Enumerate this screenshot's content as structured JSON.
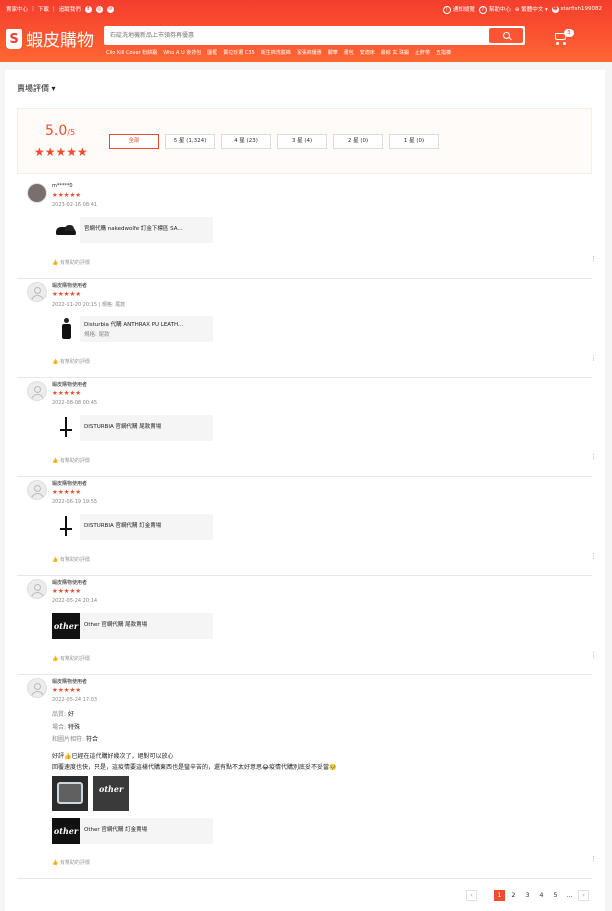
{
  "topbar": {
    "seller_center": "賣家中心",
    "download": "下載",
    "follow_us": "追蹤我們",
    "facebook_icon": "f",
    "instagram_icon": "◎",
    "line_icon": "✉",
    "notifications": "通知總覽",
    "notifications_badge": "!",
    "help": "幫助中心",
    "help_icon": "?",
    "language": "繁體中文",
    "language_icon": "⊕",
    "username": "starfish199082",
    "user_icon": "☻"
  },
  "header": {
    "logo_mark": "S",
    "logo_text": "蝦皮購物",
    "search_placeholder": "石碇洗地機新品上市領券再優惠",
    "cart_count": "3",
    "hints": [
      "Clio Kill Cover 粉餅霜",
      "Who A U 後背包",
      "圖框",
      "賣拉珍選 C35",
      "衛生棉洗臉棉",
      "潔張商優惠",
      "腳華",
      "書包",
      "安適床",
      "最綜 玄 珠鍛",
      "止鼾帶",
      "五指襪"
    ]
  },
  "ratings": {
    "title": "賣場評價",
    "score": "5.0",
    "score_suffix": "/5",
    "score_stars": "★★★★★",
    "filters": [
      {
        "label": "全部",
        "active": true
      },
      {
        "label": "5 星 (1,324)"
      },
      {
        "label": "4 星 (23)"
      },
      {
        "label": "3 星 (4)"
      },
      {
        "label": "2 星 (0)"
      },
      {
        "label": "1 星 (0)"
      }
    ]
  },
  "reviews": [
    {
      "user": "m*****0",
      "stars": "★★★★★",
      "date": "2023-02-16 08:41",
      "product": "官網代購 nakedwolfe 訂金下標區 SA...",
      "variation": "",
      "helpful": "有幫助的評價"
    },
    {
      "user": "蝦皮購物使用者",
      "stars": "★★★★★",
      "date": "2022-11-20 20:15 | 規格: 尾款",
      "product": "Disturbia 代購 ANTHRAX PU LEATH...",
      "variation": "規格: 尾款",
      "helpful": "有幫助的評價"
    },
    {
      "user": "蝦皮購物使用者",
      "stars": "★★★★★",
      "date": "2022-08-08 00:45",
      "product": "DISTURBIA 官網代購 尾款賣場",
      "variation": "",
      "helpful": "有幫助的評價"
    },
    {
      "user": "蝦皮購物使用者",
      "stars": "★★★★★",
      "date": "2022-06-19 19:55",
      "product": "DISTURBIA 官網代購 訂金賣場",
      "variation": "",
      "helpful": "有幫助的評價"
    },
    {
      "user": "蝦皮購物使用者",
      "stars": "★★★★★",
      "date": "2022-05-24 20:14",
      "product": "Other 官網代購 尾款賣場",
      "variation": "",
      "helpful": "有幫助的評價"
    },
    {
      "user": "蝦皮購物使用者",
      "stars": "★★★★★",
      "date": "2022-05-24 17:03",
      "product": "Other 官網代購 訂金賣場",
      "variation": "",
      "helpful": "有幫助的評價",
      "attr_quality_label": "品質:",
      "attr_quality": "好",
      "attr_occasion_label": "場合:",
      "attr_occasion": "特殊",
      "attr_match_label": "和圖片相符:",
      "attr_match": "符合",
      "text_line1": "好評👍已經在這代購好幾次了，絕對可以放心",
      "text_line2": "回覆速度也快，只是，這疫情要這樣代購東西也是蠻辛苦的，還有點不太好意思😂疫情代購別底妥不妥當🥺"
    }
  ],
  "brand_thumb": "other",
  "helpful_icon": "👍",
  "more_icon": "⋮",
  "pagination": {
    "prev": "‹",
    "pages": [
      "1",
      "2",
      "3",
      "4",
      "5"
    ],
    "ellipsis": "...",
    "next": "›",
    "current": "1"
  }
}
